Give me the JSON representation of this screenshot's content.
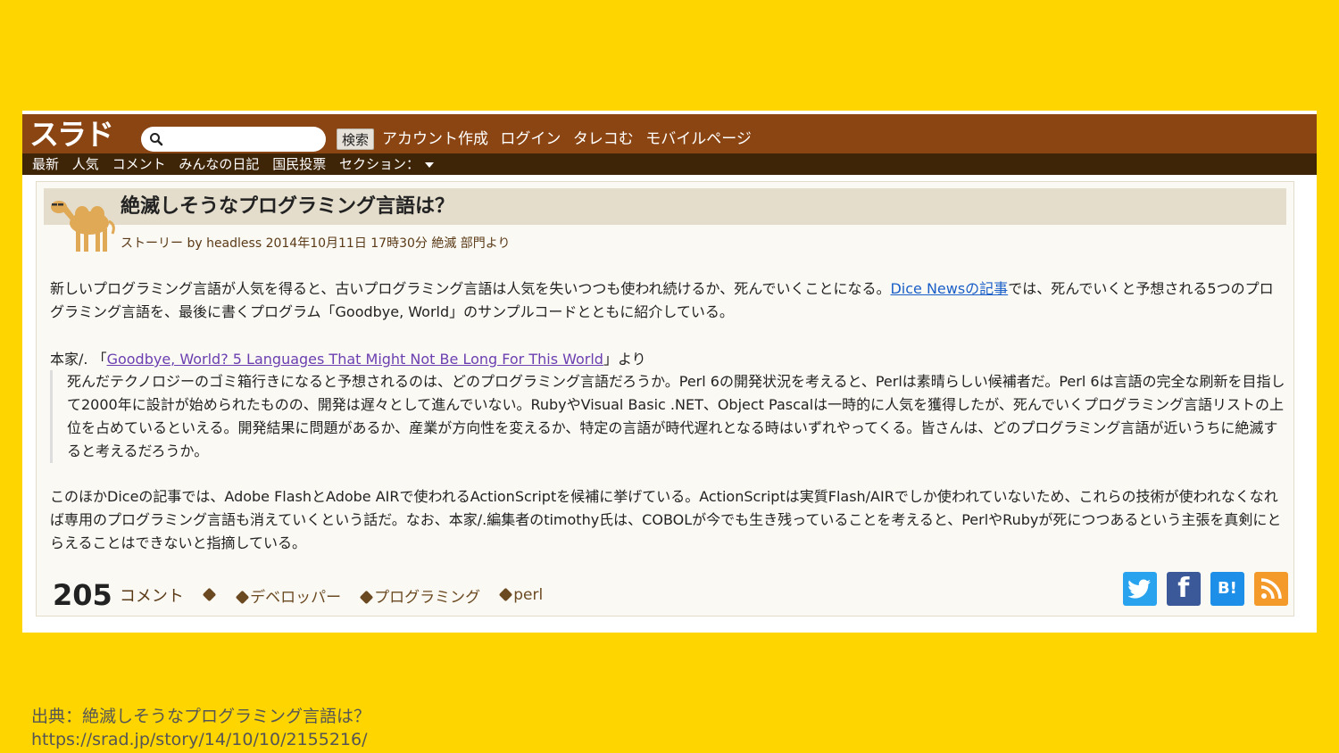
{
  "colors": {
    "page_background": "#FFD500",
    "top_bar": "#8B4513",
    "nav_bar": "#3F2508",
    "title_bar": "#E4DDCC",
    "link": "#1A5FC8",
    "visited_link": "#6B3FB0"
  },
  "header": {
    "logo": "スラド",
    "search_placeholder": "",
    "search_button": "検索",
    "links": [
      "アカウント作成",
      "ログイン",
      "タレコむ",
      "モバイルページ"
    ]
  },
  "nav": {
    "items": [
      "最新",
      "人気",
      "コメント",
      "みんなの日記",
      "国民投票"
    ],
    "sections_label": "セクション："
  },
  "article": {
    "title": "絶滅しそうなプログラミング言語は？",
    "byline": "ストーリー by headless 2014年10月11日 17時30分 絶滅 部門より",
    "p1_before": "新しいプログラミング言語が人気を得ると、古いプログラミング言語は人気を失いつつも使われ続けるか、死んでいくことになる。",
    "p1_link": "Dice Newsの記事",
    "p1_after": "では、死んでいくと予想される5つのプログラミング言語を、最後に書くプログラム「Goodbye, World」のサンプルコードとともに紹介している。",
    "quote_prefix": "本家/. 「",
    "quote_link": "Goodbye, World? 5 Languages That Might Not Be Long For This World",
    "quote_suffix": "」より",
    "quote_text": "死んだテクノロジーのゴミ箱行きになると予想されるのは、どのプログラミング言語だろうか。Perl 6の開発状況を考えると、Perlは素晴らしい候補者だ。Perl 6は言語の完全な刷新を目指して2000年に設計が始められたものの、開発は遅々として進んでいない。RubyやVisual Basic .NET、Object Pascalは一時的に人気を獲得したが、死んでいくプログラミング言語リストの上位を占めているといえる。開発結果に問題があるか、産業が方向性を変えるか、特定の言語が時代遅れとなる時はいずれやってくる。皆さんは、どのプログラミング言語が近いうちに絶滅すると考えるだろうか。",
    "p2": "このほかDiceの記事では、Adobe FlashとAdobe AIRで使われるActionScriptを候補に挙げている。ActionScriptは実質Flash/AIRでしか使われていないため、これらの技術が使われなくなれば専用のプログラミング言語も消えていくという話だ。なお、本家/.編集者のtimothy氏は、COBOLが今でも生き残っていることを考えると、PerlやRubyが死につつあるという主張を真剣にとらえることはできないと指摘している。",
    "comment_count": "205",
    "comment_label": "コメント",
    "tags": [
      "デベロッパー",
      "プログラミング",
      "perl"
    ]
  },
  "share": {
    "icons": [
      "twitter-icon",
      "facebook-icon",
      "hatena-bookmark-icon",
      "rss-icon"
    ],
    "hatena_label": "B!",
    "facebook_label": "f"
  },
  "credit": {
    "line1": "出典：絶滅しそうなプログラミング言語は？",
    "line2": "https://srad.jp/story/14/10/10/2155216/"
  }
}
